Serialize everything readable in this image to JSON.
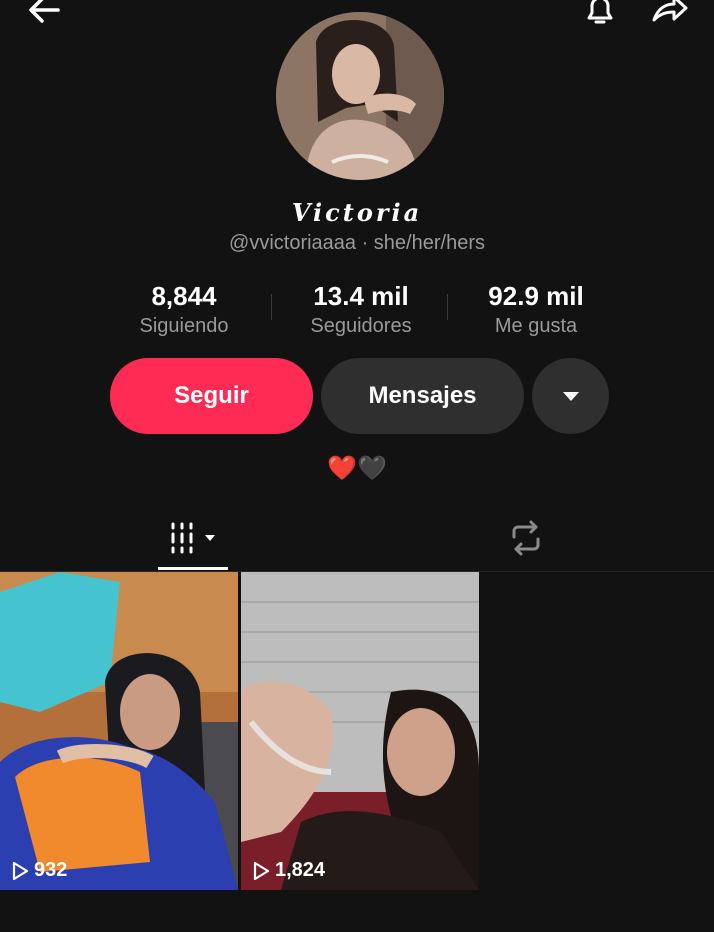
{
  "profile": {
    "display_name": "Victoria",
    "handle": "@vvictoriaaaa · she/her/hers",
    "bio": "❤️🖤"
  },
  "stats": [
    {
      "value": "8,844",
      "label": "Siguiendo"
    },
    {
      "value": "13.4 mil",
      "label": "Seguidores"
    },
    {
      "value": "92.9 mil",
      "label": "Me gusta"
    }
  ],
  "actions": {
    "follow_label": "Seguir",
    "message_label": "Mensajes"
  },
  "tabs": [
    {
      "icon": "videos-grid-icon",
      "active": true
    },
    {
      "icon": "repost-icon",
      "active": false
    }
  ],
  "videos": [
    {
      "views": "932"
    },
    {
      "views": "1,824"
    }
  ],
  "colors": {
    "accent": "#fe2c55",
    "background": "#121212",
    "button_secondary": "#2f2f2f",
    "muted_text": "#9a9a9a"
  }
}
